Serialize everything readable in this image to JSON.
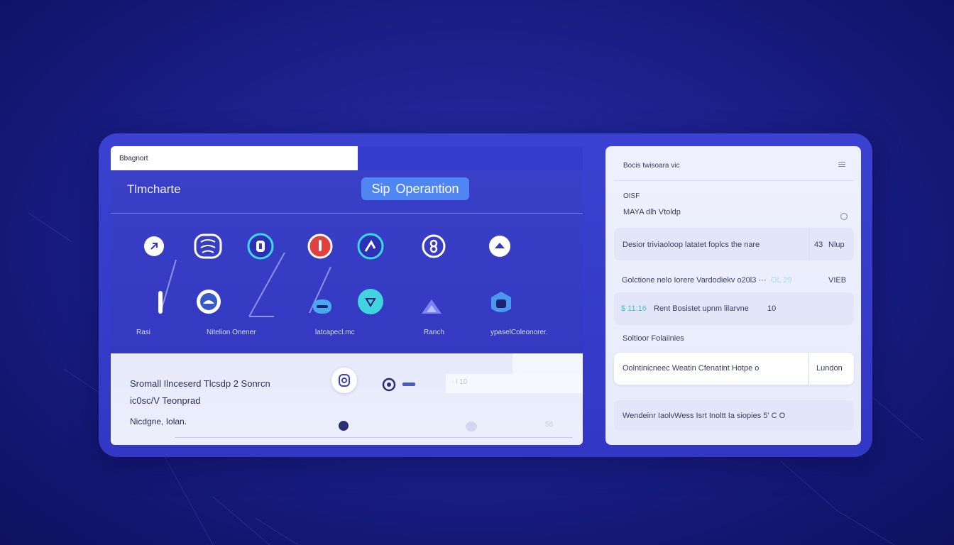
{
  "left_panel": {
    "tab_label": "Bbagnort",
    "title": "Tlmcharte",
    "primary_button": {
      "label_a": "Sip",
      "label_b": "Operantion"
    },
    "icon_row_1": [
      {
        "name": "send-icon"
      },
      {
        "name": "brain-icon"
      },
      {
        "name": "lock-icon"
      },
      {
        "name": "alert-icon"
      },
      {
        "name": "tool-icon"
      },
      {
        "name": "sync-icon"
      },
      {
        "name": "upload-icon"
      }
    ],
    "icon_row_2": [
      {
        "name": "bar-icon"
      },
      {
        "name": "cloud-icon"
      },
      {
        "name": "pen-icon"
      },
      {
        "name": "toggle-icon"
      },
      {
        "name": "network-icon"
      },
      {
        "name": "triangle-icon"
      },
      {
        "name": "shield-icon"
      }
    ],
    "labels": [
      "Rasi",
      "Nitelion Onener",
      "latcapecl.mc",
      "Ranch",
      "ypaselColeonorer."
    ],
    "bottom": {
      "line1": "Sromall Ilnceserd Tlcsdp 2 Sonrcn",
      "line2": "ic0sc/V Teonprad",
      "line3": "Nicdgne,  Iolan.",
      "box_text": "·  l  10",
      "faint_right": "56"
    }
  },
  "right_panel": {
    "header": "Bocis twisoara vic",
    "label_a": "OISF",
    "label_b": "MAYA dlh Vtoldp",
    "row1": {
      "text": "Desior triviaoloop latatet foplcs the nare",
      "value": "43",
      "unit": "Nlup"
    },
    "row2": {
      "text": "Golctione nelo  Iorere Vardodiekv o20l3 ···",
      "accent": "OL 29",
      "value": "VIEB"
    },
    "row3": {
      "tag": "$ 11:16",
      "text": "Rent  Bosistet upnm lilarvne",
      "value": "10"
    },
    "section": "Soltioor Folaiinies",
    "row4": {
      "text": "Oolntinicneec  Weatin  Cfenatint Hotpe  o",
      "value": "Lundon"
    },
    "row5": {
      "text": "Wendeinr IaolvWess  Isrt  Inoltt  Ia siopies 5' C  O"
    }
  },
  "colors": {
    "background": "#1e2290",
    "panel": "#3a40c8",
    "button": "#4f86f2",
    "card": "#eef0fd",
    "accent_teal": "#3fd7e6",
    "accent_red": "#e0413f"
  }
}
